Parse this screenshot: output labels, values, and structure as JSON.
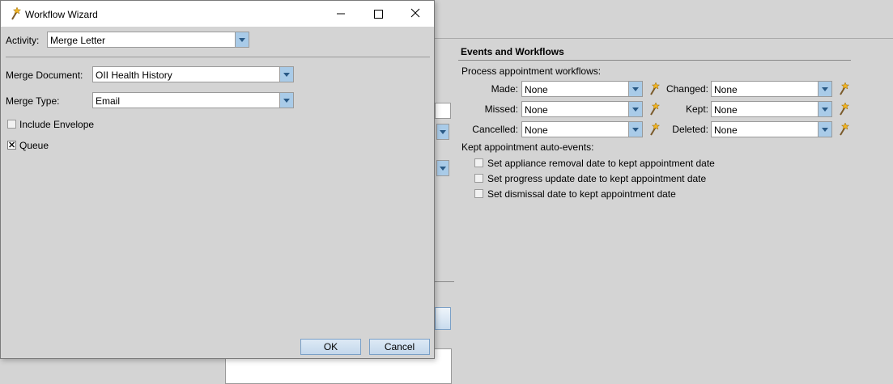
{
  "background": {
    "events": {
      "title": "Events and Workflows",
      "process_label": "Process appointment workflows:",
      "rows": [
        {
          "left_label": "Made:",
          "left_value": "None",
          "right_label": "Changed:",
          "right_value": "None"
        },
        {
          "left_label": "Missed:",
          "left_value": "None",
          "right_label": "Kept:",
          "right_value": "None"
        },
        {
          "left_label": "Cancelled:",
          "left_value": "None",
          "right_label": "Deleted:",
          "right_value": "None"
        }
      ],
      "auto_events_label": "Kept appointment auto-events:",
      "auto_events": [
        {
          "label": "Set appliance removal date to kept appointment date",
          "checked": false
        },
        {
          "label": "Set progress update date to kept appointment date",
          "checked": false
        },
        {
          "label": "Set dismissal date to kept appointment date",
          "checked": false
        }
      ]
    }
  },
  "dialog": {
    "title": "Workflow Wizard",
    "activity_label": "Activity:",
    "activity_value": "Merge Letter",
    "merge_document_label": "Merge Document:",
    "merge_document_value": "OII Health History",
    "merge_type_label": "Merge Type:",
    "merge_type_value": "Email",
    "include_envelope_label": "Include Envelope",
    "include_envelope_checked": false,
    "queue_label": "Queue",
    "queue_checked": true,
    "ok_label": "OK",
    "cancel_label": "Cancel"
  },
  "colors": {
    "accent": "#a9cbe8",
    "background": "#d4d4d4"
  }
}
